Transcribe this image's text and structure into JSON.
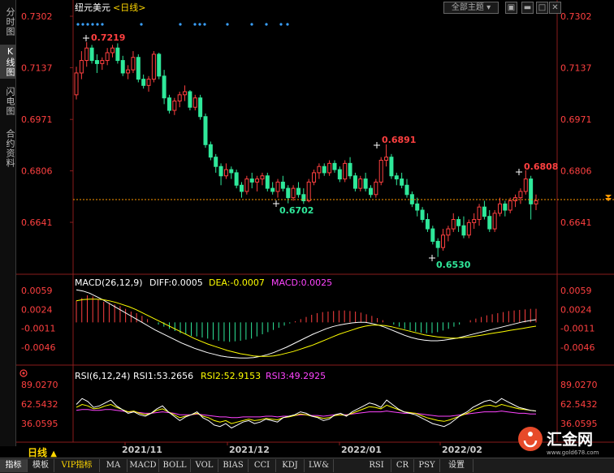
{
  "sidebar": {
    "tabs": [
      {
        "label": "分时图",
        "active": false
      },
      {
        "label": "K线图",
        "active": true
      },
      {
        "label": "闪电图",
        "active": false
      },
      {
        "label": "合约资料",
        "active": false
      }
    ]
  },
  "header": {
    "instrument": "纽元美元",
    "period_tag": "<日线>",
    "theme_button": "全部主题",
    "window_icons": [
      "restore-icon",
      "minimize-icon",
      "maximize-icon",
      "close-icon"
    ]
  },
  "main_panel": {
    "price_axis_left": [
      "0.7302",
      "0.7137",
      "0.6971",
      "0.6806",
      "0.6641"
    ],
    "price_axis_right": [
      "0.7302",
      "0.7137",
      "0.6971",
      "0.6806",
      "0.6641"
    ],
    "annotations": [
      "0.7219",
      "0.6891",
      "0.6702",
      "0.6808",
      "0.6530"
    ]
  },
  "macd_panel": {
    "title": "MACD(26,12,9)",
    "diff": "DIFF:0.0005",
    "dea": "DEA:-0.0007",
    "macd": "MACD:0.0025",
    "axis_labels": [
      "0.0059",
      "0.0024",
      "-0.0011",
      "-0.0046"
    ]
  },
  "rsi_panel": {
    "title": "RSI(6,12,24)",
    "rsi1": "RSI1:53.2656",
    "rsi2": "RSI2:52.9153",
    "rsi3": "RSI3:49.2925",
    "axis_labels": [
      "89.0270",
      "62.5432",
      "36.0595"
    ]
  },
  "time_axis": [
    "2021/11",
    "2021/12",
    "2022/01",
    "2022/02"
  ],
  "period_label": "日线",
  "bottom_tabs": [
    "指标",
    "模板",
    "VIP指标",
    "MA",
    "MACD",
    "BOLL",
    "VOL",
    "BIAS",
    "CCI",
    "KDJ",
    "LW&",
    "RSI",
    "CR",
    "PSY",
    "设置"
  ],
  "logo": {
    "name": "汇金网",
    "url": "www.gold678.com"
  },
  "colors": {
    "up": "#ff4040",
    "down": "#2fe89a",
    "axis_text": "#ff4040",
    "diff": "#ffffff",
    "dea": "#ffff00",
    "macd": "#ff44ff",
    "rsi1": "#ffffff",
    "rsi2": "#ffff00",
    "rsi3": "#ff44ff"
  },
  "chart_data": {
    "type": "candlestick",
    "title": "纽元美元 <日线>",
    "ylim": [
      0.65,
      0.7302
    ],
    "annotated_points": [
      {
        "label": "0.7219",
        "type": "high"
      },
      {
        "label": "0.6891",
        "type": "high"
      },
      {
        "label": "0.6702",
        "type": "low"
      },
      {
        "label": "0.6808",
        "type": "high"
      },
      {
        "label": "0.6530",
        "type": "low"
      }
    ],
    "ohlc": [
      [
        0.705,
        0.714,
        0.7035,
        0.712
      ],
      [
        0.712,
        0.719,
        0.71,
        0.716
      ],
      [
        0.716,
        0.7219,
        0.714,
        0.72
      ],
      [
        0.72,
        0.721,
        0.715,
        0.716
      ],
      [
        0.716,
        0.718,
        0.712,
        0.715
      ],
      [
        0.715,
        0.717,
        0.713,
        0.716
      ],
      [
        0.716,
        0.72,
        0.7145,
        0.7185
      ],
      [
        0.7185,
        0.721,
        0.717,
        0.72
      ],
      [
        0.72,
        0.7215,
        0.715,
        0.716
      ],
      [
        0.716,
        0.7175,
        0.711,
        0.712
      ],
      [
        0.712,
        0.7145,
        0.71,
        0.713
      ],
      [
        0.713,
        0.719,
        0.712,
        0.717
      ],
      [
        0.717,
        0.718,
        0.709,
        0.71
      ],
      [
        0.71,
        0.7115,
        0.707,
        0.708
      ],
      [
        0.708,
        0.711,
        0.706,
        0.71
      ],
      [
        0.71,
        0.719,
        0.709,
        0.718
      ],
      [
        0.718,
        0.7185,
        0.71,
        0.711
      ],
      [
        0.711,
        0.713,
        0.702,
        0.704
      ],
      [
        0.704,
        0.705,
        0.699,
        0.7
      ],
      [
        0.7,
        0.704,
        0.6985,
        0.703
      ],
      [
        0.703,
        0.706,
        0.701,
        0.705
      ],
      [
        0.705,
        0.708,
        0.703,
        0.706
      ],
      [
        0.706,
        0.7065,
        0.7,
        0.701
      ],
      [
        0.701,
        0.705,
        0.7,
        0.704
      ],
      [
        0.704,
        0.705,
        0.697,
        0.698
      ],
      [
        0.698,
        0.699,
        0.688,
        0.689
      ],
      [
        0.689,
        0.69,
        0.684,
        0.685
      ],
      [
        0.685,
        0.686,
        0.68,
        0.682
      ],
      [
        0.682,
        0.683,
        0.676,
        0.679
      ],
      [
        0.679,
        0.683,
        0.678,
        0.681
      ],
      [
        0.681,
        0.682,
        0.678,
        0.68
      ],
      [
        0.68,
        0.681,
        0.675,
        0.676
      ],
      [
        0.676,
        0.677,
        0.672,
        0.674
      ],
      [
        0.674,
        0.679,
        0.673,
        0.678
      ],
      [
        0.678,
        0.68,
        0.675,
        0.677
      ],
      [
        0.677,
        0.679,
        0.674,
        0.678
      ],
      [
        0.678,
        0.68,
        0.676,
        0.679
      ],
      [
        0.679,
        0.68,
        0.674,
        0.675
      ],
      [
        0.675,
        0.677,
        0.673,
        0.674
      ],
      [
        0.674,
        0.678,
        0.672,
        0.677
      ],
      [
        0.677,
        0.679,
        0.674,
        0.675
      ],
      [
        0.675,
        0.676,
        0.6702,
        0.672
      ],
      [
        0.672,
        0.676,
        0.671,
        0.675
      ],
      [
        0.675,
        0.677,
        0.672,
        0.673
      ],
      [
        0.673,
        0.675,
        0.67,
        0.671
      ],
      [
        0.671,
        0.678,
        0.6705,
        0.677
      ],
      [
        0.677,
        0.681,
        0.676,
        0.68
      ],
      [
        0.68,
        0.683,
        0.678,
        0.682
      ],
      [
        0.682,
        0.683,
        0.679,
        0.68
      ],
      [
        0.68,
        0.684,
        0.679,
        0.683
      ],
      [
        0.683,
        0.684,
        0.68,
        0.681
      ],
      [
        0.681,
        0.682,
        0.677,
        0.678
      ],
      [
        0.678,
        0.684,
        0.677,
        0.683
      ],
      [
        0.683,
        0.685,
        0.678,
        0.679
      ],
      [
        0.679,
        0.68,
        0.674,
        0.675
      ],
      [
        0.675,
        0.679,
        0.674,
        0.678
      ],
      [
        0.678,
        0.68,
        0.674,
        0.675
      ],
      [
        0.675,
        0.676,
        0.672,
        0.673
      ],
      [
        0.673,
        0.678,
        0.672,
        0.677
      ],
      [
        0.677,
        0.685,
        0.676,
        0.684
      ],
      [
        0.684,
        0.6891,
        0.682,
        0.685
      ],
      [
        0.685,
        0.686,
        0.678,
        0.679
      ],
      [
        0.679,
        0.68,
        0.676,
        0.678
      ],
      [
        0.678,
        0.68,
        0.675,
        0.676
      ],
      [
        0.676,
        0.678,
        0.672,
        0.673
      ],
      [
        0.673,
        0.674,
        0.669,
        0.67
      ],
      [
        0.67,
        0.672,
        0.666,
        0.668
      ],
      [
        0.668,
        0.669,
        0.664,
        0.665
      ],
      [
        0.665,
        0.667,
        0.661,
        0.662
      ],
      [
        0.662,
        0.663,
        0.657,
        0.658
      ],
      [
        0.658,
        0.659,
        0.653,
        0.656
      ],
      [
        0.656,
        0.662,
        0.655,
        0.66
      ],
      [
        0.66,
        0.663,
        0.658,
        0.662
      ],
      [
        0.662,
        0.667,
        0.661,
        0.665
      ],
      [
        0.665,
        0.666,
        0.661,
        0.663
      ],
      [
        0.663,
        0.666,
        0.659,
        0.66
      ],
      [
        0.66,
        0.665,
        0.659,
        0.664
      ],
      [
        0.664,
        0.667,
        0.662,
        0.665
      ],
      [
        0.665,
        0.67,
        0.663,
        0.669
      ],
      [
        0.669,
        0.671,
        0.665,
        0.666
      ],
      [
        0.666,
        0.668,
        0.661,
        0.662
      ],
      [
        0.662,
        0.668,
        0.661,
        0.667
      ],
      [
        0.667,
        0.672,
        0.666,
        0.67
      ],
      [
        0.67,
        0.671,
        0.666,
        0.668
      ],
      [
        0.668,
        0.672,
        0.667,
        0.671
      ],
      [
        0.671,
        0.673,
        0.669,
        0.672
      ],
      [
        0.672,
        0.675,
        0.67,
        0.674
      ],
      [
        0.674,
        0.6808,
        0.673,
        0.678
      ],
      [
        0.678,
        0.679,
        0.665,
        0.67
      ],
      [
        0.67,
        0.673,
        0.668,
        0.671
      ]
    ],
    "macd_hist": [
      0.004,
      0.0045,
      0.005,
      0.0048,
      0.0042,
      0.0038,
      0.0036,
      0.0033,
      0.003,
      0.0025,
      0.002,
      0.0017,
      0.0012,
      0.0006,
      0.0,
      -0.0004,
      -0.0008,
      -0.0012,
      -0.0016,
      -0.002,
      -0.0022,
      -0.0025,
      -0.0026,
      -0.0028,
      -0.003,
      -0.0032,
      -0.0034,
      -0.0035,
      -0.0036,
      -0.0035,
      -0.0034,
      -0.0032,
      -0.003,
      -0.0026,
      -0.0022,
      -0.0018,
      -0.0014,
      -0.001,
      -0.0006,
      -0.0002,
      0.0002,
      0.0006,
      0.001,
      0.0014,
      0.0017,
      0.0019,
      0.002,
      0.0021,
      0.0022,
      0.0022,
      0.0021,
      0.002,
      0.0018,
      0.0015,
      0.0012,
      0.0008,
      0.0004,
      0.0,
      -0.0004,
      -0.0008,
      -0.0012,
      -0.0015,
      -0.0017,
      -0.0019,
      -0.002,
      -0.002,
      -0.0018,
      -0.0015,
      -0.0012,
      -0.0008,
      -0.0004,
      0.0,
      0.0004,
      0.0007,
      0.001,
      0.0013,
      0.0015,
      0.0017,
      0.0019,
      0.0021,
      0.0022,
      0.0023,
      0.0024,
      0.0025,
      0.0025
    ],
    "macd_diff": [
      0.006,
      0.0058,
      0.0054,
      0.0048,
      0.0042,
      0.0035,
      0.0028,
      0.0021,
      0.0014,
      0.0007,
      0.0,
      -0.0007,
      -0.0014,
      -0.002,
      -0.0026,
      -0.0032,
      -0.0038,
      -0.0043,
      -0.0048,
      -0.0052,
      -0.0056,
      -0.0059,
      -0.0062,
      -0.0064,
      -0.0065,
      -0.0066,
      -0.0066,
      -0.0065,
      -0.0063,
      -0.006,
      -0.0056,
      -0.0051,
      -0.0046,
      -0.004,
      -0.0034,
      -0.0028,
      -0.0022,
      -0.0017,
      -0.0012,
      -0.0008,
      -0.0005,
      -0.0003,
      -0.0001,
      0.0,
      0.0,
      -0.0002,
      -0.0005,
      -0.0009,
      -0.0014,
      -0.0019,
      -0.0024,
      -0.0028,
      -0.0031,
      -0.0033,
      -0.0034,
      -0.0034,
      -0.0033,
      -0.0031,
      -0.0029,
      -0.0026,
      -0.0023,
      -0.002,
      -0.0017,
      -0.0014,
      -0.0011,
      -0.0008,
      -0.0005,
      -0.0002,
      0.0001,
      0.0003,
      0.0005
    ],
    "macd_dea": [
      0.004,
      0.0042,
      0.0043,
      0.0043,
      0.0042,
      0.004,
      0.0037,
      0.0033,
      0.0029,
      0.0024,
      0.0018,
      0.0012,
      0.0006,
      0.0,
      -0.0006,
      -0.0012,
      -0.0018,
      -0.0024,
      -0.003,
      -0.0035,
      -0.004,
      -0.0044,
      -0.0048,
      -0.0052,
      -0.0055,
      -0.0058,
      -0.006,
      -0.0062,
      -0.0063,
      -0.0063,
      -0.0062,
      -0.006,
      -0.0057,
      -0.0054,
      -0.005,
      -0.0046,
      -0.0042,
      -0.0037,
      -0.0032,
      -0.0027,
      -0.0022,
      -0.0018,
      -0.0014,
      -0.001,
      -0.0007,
      -0.0005,
      -0.0005,
      -0.0006,
      -0.0008,
      -0.0011,
      -0.0014,
      -0.0017,
      -0.002,
      -0.0023,
      -0.0025,
      -0.0027,
      -0.0028,
      -0.0029,
      -0.0029,
      -0.0028,
      -0.0027,
      -0.0025,
      -0.0023,
      -0.0021,
      -0.0019,
      -0.0017,
      -0.0015,
      -0.0013,
      -0.0011,
      -0.0009,
      -0.0007
    ],
    "rsi1": [
      62,
      70,
      66,
      58,
      60,
      64,
      68,
      60,
      55,
      50,
      52,
      48,
      46,
      50,
      56,
      60,
      52,
      46,
      40,
      45,
      48,
      52,
      44,
      40,
      34,
      32,
      36,
      30,
      34,
      38,
      40,
      36,
      38,
      42,
      40,
      38,
      44,
      46,
      48,
      52,
      50,
      46,
      44,
      40,
      42,
      48,
      50,
      46,
      52,
      56,
      60,
      64,
      62,
      58,
      68,
      62,
      56,
      52,
      50,
      48,
      44,
      40,
      36,
      34,
      32,
      36,
      42,
      48,
      52,
      58,
      62,
      66,
      68,
      64,
      70,
      66,
      62,
      58,
      56,
      54,
      53
    ],
    "rsi2": [
      58,
      62,
      60,
      56,
      57,
      60,
      62,
      58,
      55,
      52,
      53,
      50,
      48,
      50,
      54,
      56,
      52,
      48,
      44,
      46,
      48,
      50,
      46,
      44,
      40,
      38,
      40,
      36,
      38,
      40,
      42,
      40,
      41,
      43,
      42,
      41,
      44,
      45,
      47,
      49,
      48,
      46,
      45,
      43,
      44,
      47,
      48,
      47,
      50,
      53,
      56,
      59,
      58,
      56,
      61,
      58,
      55,
      52,
      51,
      50,
      47,
      44,
      42,
      40,
      39,
      41,
      44,
      47,
      50,
      54,
      57,
      60,
      61,
      59,
      62,
      60,
      58,
      56,
      55,
      54,
      53
    ],
    "rsi3": [
      54,
      55,
      55,
      54,
      54,
      55,
      55,
      54,
      53,
      52,
      52,
      51,
      50,
      50,
      51,
      52,
      51,
      50,
      48,
      48,
      48,
      49,
      48,
      47,
      46,
      45,
      45,
      44,
      44,
      45,
      45,
      45,
      45,
      46,
      46,
      45,
      46,
      46,
      47,
      48,
      48,
      47,
      47,
      46,
      47,
      48,
      48,
      48,
      49,
      50,
      51,
      52,
      52,
      52,
      53,
      52,
      51,
      50,
      50,
      50,
      49,
      48,
      47,
      46,
      46,
      46,
      47,
      48,
      49,
      50,
      51,
      52,
      52,
      52,
      53,
      52,
      51,
      50,
      50,
      49,
      49
    ]
  }
}
